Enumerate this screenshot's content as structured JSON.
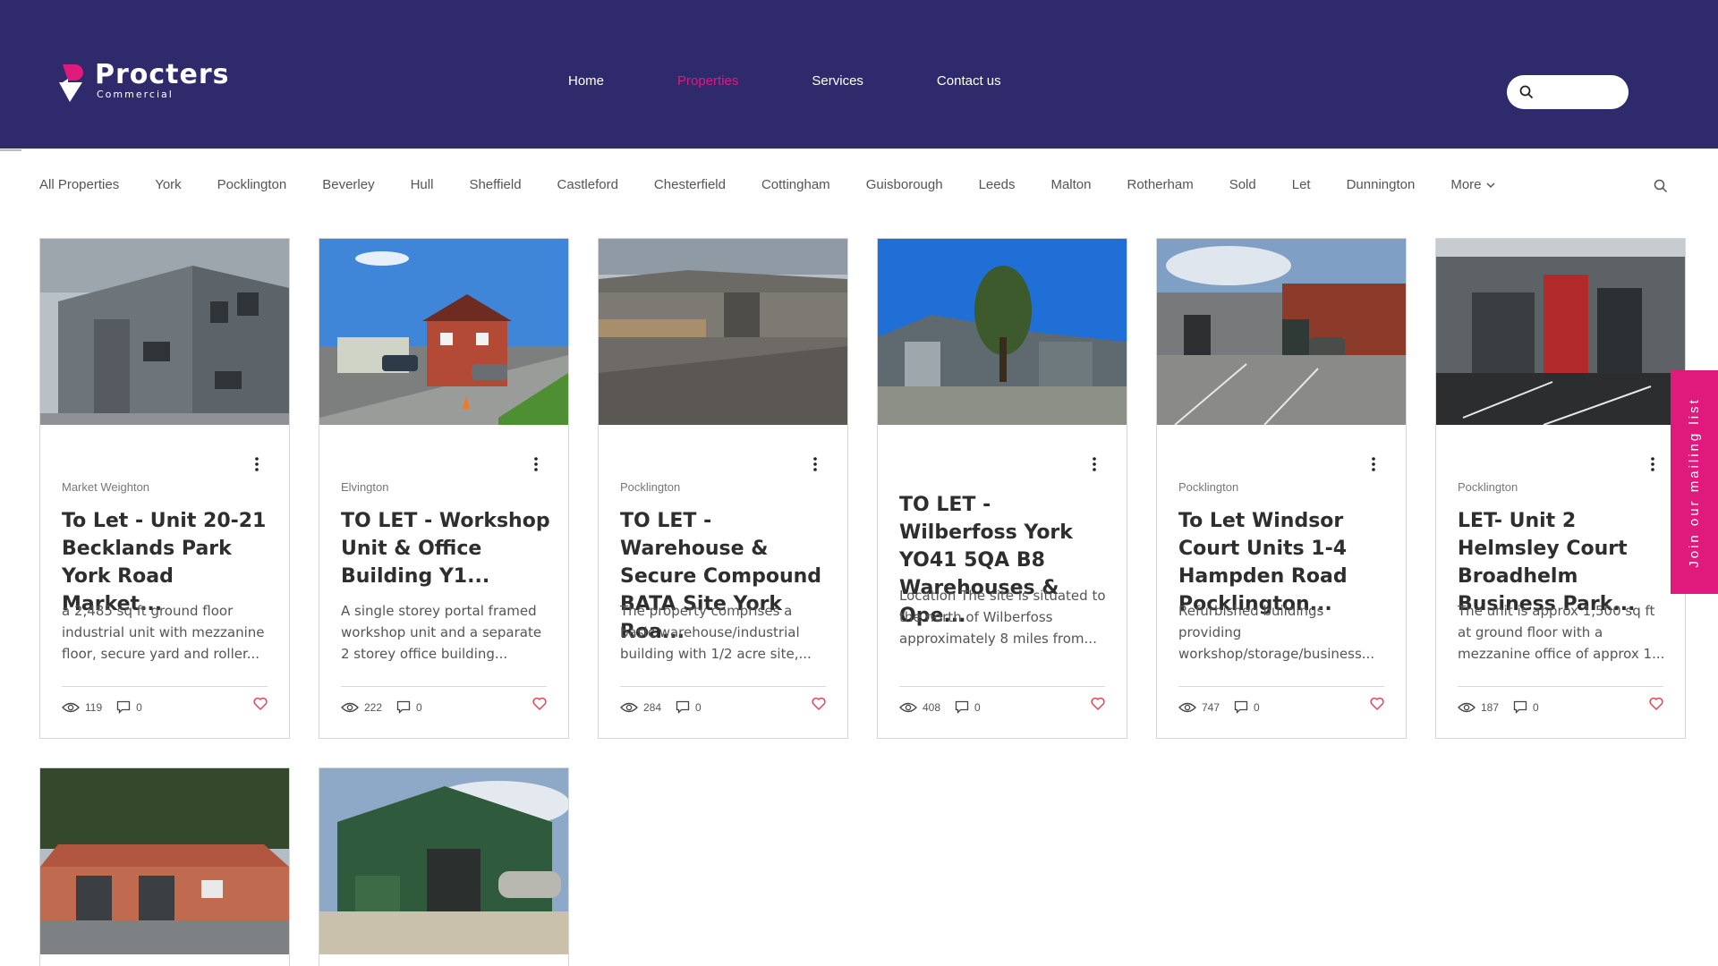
{
  "brand": {
    "name": "Procters",
    "sub": "Commercial",
    "color": "#2e2a6b",
    "accent": "#e0197d"
  },
  "nav": [
    {
      "label": "Home",
      "active": false
    },
    {
      "label": "Properties",
      "active": true
    },
    {
      "label": "Services",
      "active": false
    },
    {
      "label": "Contact us",
      "active": false
    }
  ],
  "search": {
    "placeholder": ""
  },
  "categories": [
    "All Properties",
    "York",
    "Pocklington",
    "Beverley",
    "Hull",
    "Sheffield",
    "Castleford",
    "Chesterfield",
    "Cottingham",
    "Guisborough",
    "Leeds",
    "Malton",
    "Rotherham",
    "Sold",
    "Let",
    "Dunnington"
  ],
  "more_label": "More",
  "posts": [
    {
      "location": "Market Weighton",
      "title": "To Let - Unit 20-21 Becklands Park York Road Market...",
      "excerpt": "a 2,485 sq ft ground floor industrial unit with mezzanine floor, secure yard and roller...",
      "views": "119",
      "comments": "0"
    },
    {
      "location": "Elvington",
      "title": "TO LET - Workshop Unit & Office Building Y1...",
      "excerpt": "A single storey portal framed workshop unit and a separate 2 storey office building...",
      "views": "222",
      "comments": "0"
    },
    {
      "location": "Pocklington",
      "title": "TO LET - Warehouse & Secure Compound BATA Site York Roa...",
      "excerpt": "The property comprises a basic warehouse/industrial building with 1/2 acre site,...",
      "views": "284",
      "comments": "0"
    },
    {
      "location": "",
      "title": "TO LET - Wilberfoss York YO41 5QA B8 Warehouses & Ope...",
      "excerpt": "Location The site is situated to the north of Wilberfoss approximately 8 miles from...",
      "views": "408",
      "comments": "0"
    },
    {
      "location": "Pocklington",
      "title": "To Let Windsor Court Units 1-4 Hampden Road Pocklington...",
      "excerpt": "Refurbished buildings providing workshop/storage/business...",
      "views": "747",
      "comments": "0"
    },
    {
      "location": "Pocklington",
      "title": "LET- Unit 2 Helmsley Court Broadhelm Business Park...",
      "excerpt": "The unit is approx 1,500 sq ft at ground floor with a mezzanine office of approx 1...",
      "views": "187",
      "comments": "0"
    }
  ],
  "mailing_tab": "Join our mailing list"
}
